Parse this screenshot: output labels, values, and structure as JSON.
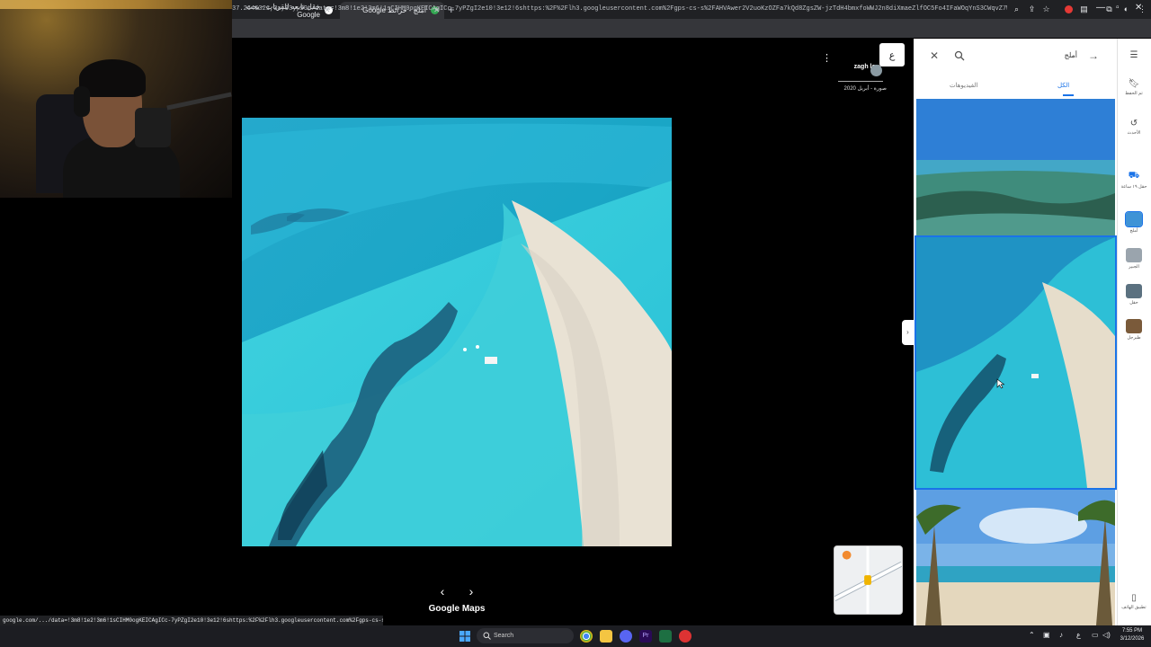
{
  "browser": {
    "tabs": [
      {
        "title": "حقل تابعه للقريات - بحث Google",
        "active": false
      },
      {
        "title": "أملج - خرائط Google",
        "active": true
      }
    ],
    "url": "37.2646321,3a,93y,90t/data=!3m8!1e2!3m6!1sCIHM0ogKEICAgICc-7yPZgI2e10!3e12!6shttps:%2F%2Flh3.googleusercontent.com%2Fgps-cs-s%2FAHVAwer2V2uoKzOZFa7kQd8ZgsZW-jzTdH4bmxfoWWJ2n8diXmaeZlfOC5Fo4IFaWOqYnS3CWqvZ7W9e6ynzRrwFb5ZxOt5-xmG1G..."
  },
  "viewer": {
    "author": "zagh loul",
    "date": "صورة - أبريل 2020",
    "lang_button": "ع",
    "brand": "Google Maps"
  },
  "sidepanel": {
    "query": "أملج",
    "tabs": [
      "الكل",
      "الفيديوهات"
    ],
    "active_tab": "الكل"
  },
  "rail": {
    "items": [
      {
        "label": "تم الحفظ",
        "icon": "bookmark-icon"
      },
      {
        "label": "الأحدث",
        "icon": "history-icon"
      },
      {
        "label": "حقل ١٩ ساعة",
        "icon": "car-icon"
      },
      {
        "label": "أملج",
        "icon": "place-thumb",
        "active": true
      },
      {
        "label": "الجبير",
        "icon": "place-thumb"
      },
      {
        "label": "حقل",
        "icon": "place-thumb"
      },
      {
        "label": "طبرجل",
        "icon": "place-thumb"
      },
      {
        "label": "تطبيق الهاتف",
        "icon": "phone-icon"
      }
    ]
  },
  "status_url": "google.com/.../data=!3m8!1e2!3m6!1sCIHM0ogKEICAgICc-7yPZgI2e10!3e12!6shttps:%2F%2Flh3.googleusercontent.com%2Fgps-cs-s%2FAHVAwer2V2uoKzO...",
  "taskbar": {
    "search_placeholder": "Search",
    "time": "7:55 PM",
    "date": "3/12/2026",
    "lang": "ع"
  },
  "colors": {
    "accent": "#1a73e8",
    "chrome_dark": "#202124",
    "taskbar": "#1c1d22"
  }
}
